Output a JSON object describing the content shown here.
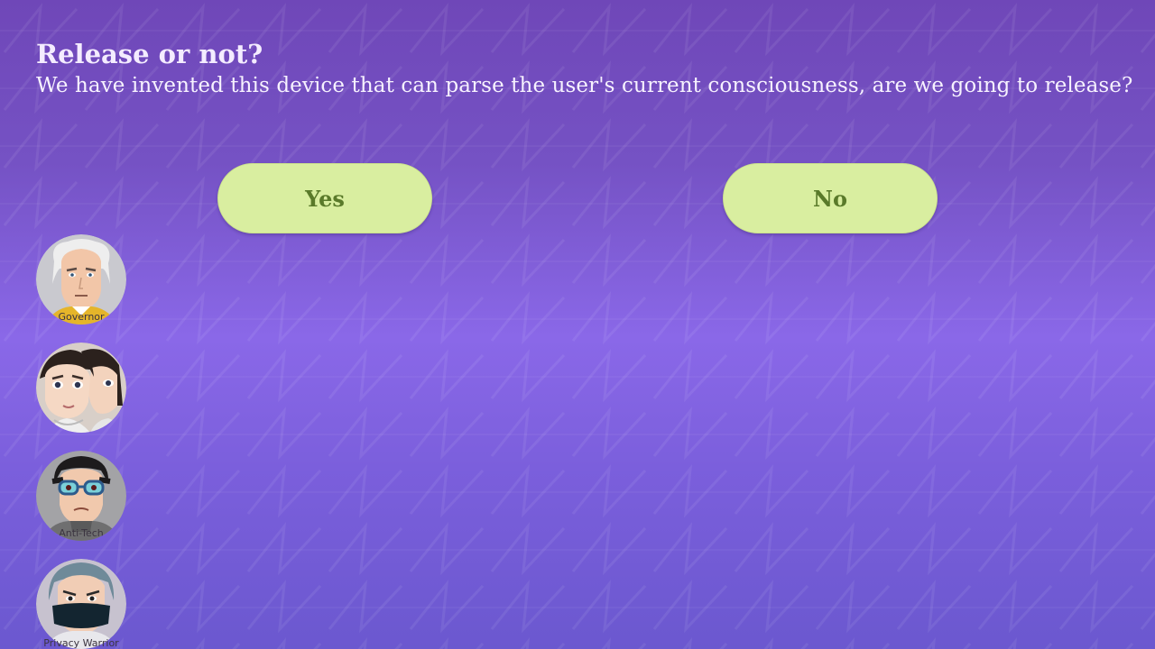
{
  "prompt": {
    "title": "Release or not?",
    "question": "We have invented this device that can parse the user's current consciousness, are we going to release?"
  },
  "choices": {
    "yes_label": "Yes",
    "no_label": "No"
  },
  "characters": [
    {
      "label": "Governor",
      "icon": "governor-avatar-icon"
    },
    {
      "label": "",
      "icon": "twins-avatar-icon"
    },
    {
      "label": "Anti-Tech",
      "icon": "anti-tech-avatar-icon"
    },
    {
      "label": "Privacy Warrior",
      "icon": "privacy-warrior-avatar-icon"
    }
  ],
  "colors": {
    "background_top": "#6f47b8",
    "background_mid": "#8a68e8",
    "button_fill": "#d9eea0",
    "button_text": "#5a7a2a",
    "text": "#f7f2ff"
  }
}
